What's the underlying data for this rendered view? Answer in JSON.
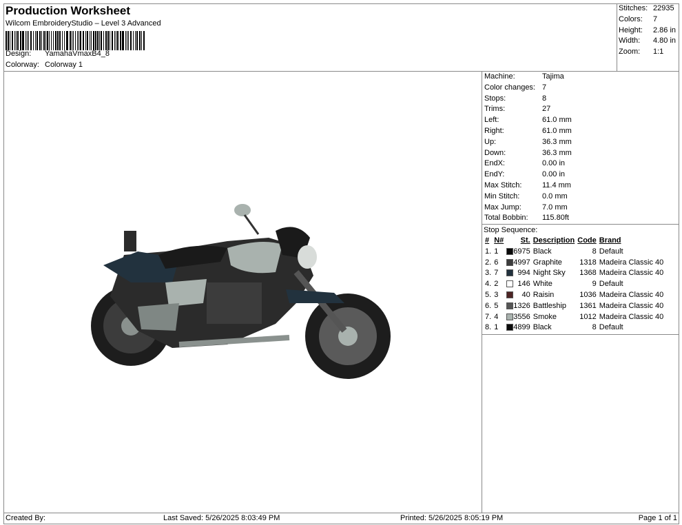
{
  "header": {
    "title": "Production Worksheet",
    "subtitle": "Wilcom EmbroideryStudio – Level 3 Advanced",
    "design_label": "Design:",
    "design": "YamahaVmaxB4_8",
    "colorway_label": "Colorway:",
    "colorway": "Colorway 1"
  },
  "summary": [
    {
      "k": "Stitches:",
      "v": "22935"
    },
    {
      "k": "Colors:",
      "v": "7"
    },
    {
      "k": "Height:",
      "v": "2.86 in"
    },
    {
      "k": "Width:",
      "v": "4.80 in"
    },
    {
      "k": "Zoom:",
      "v": "1:1"
    }
  ],
  "info": [
    {
      "k": "Machine:",
      "v": "Tajima"
    },
    {
      "k": "Color changes:",
      "v": "7"
    },
    {
      "k": "Stops:",
      "v": "8"
    },
    {
      "k": "Trims:",
      "v": "27"
    },
    {
      "k": "Left:",
      "v": "61.0 mm"
    },
    {
      "k": "Right:",
      "v": "61.0 mm"
    },
    {
      "k": "Up:",
      "v": "36.3 mm"
    },
    {
      "k": "Down:",
      "v": "36.3 mm"
    },
    {
      "k": "EndX:",
      "v": "0.00 in"
    },
    {
      "k": "EndY:",
      "v": "0.00 in"
    },
    {
      "k": "Max Stitch:",
      "v": "11.4 mm"
    },
    {
      "k": "Min Stitch:",
      "v": "0.0 mm"
    },
    {
      "k": "Max Jump:",
      "v": "7.0 mm"
    },
    {
      "k": "Total Bobbin:",
      "v": "115.80ft"
    }
  ],
  "stops": {
    "caption": "Stop Sequence:",
    "headers": [
      "#",
      "N#",
      "St.",
      "Description",
      "Code",
      "Brand"
    ],
    "rows": [
      {
        "n": "1.",
        "nn": "1",
        "color": "#0a0a0a",
        "st": "6975",
        "desc": "Black",
        "code": "8",
        "brand": "Default"
      },
      {
        "n": "2.",
        "nn": "6",
        "color": "#3c3c3c",
        "st": "4997",
        "desc": "Graphite",
        "code": "1318",
        "brand": "Madeira Classic 40"
      },
      {
        "n": "3.",
        "nn": "7",
        "color": "#22323e",
        "st": "994",
        "desc": "Night Sky",
        "code": "1368",
        "brand": "Madeira Classic 40"
      },
      {
        "n": "4.",
        "nn": "2",
        "color": "#ffffff",
        "st": "146",
        "desc": "White",
        "code": "9",
        "brand": "Default"
      },
      {
        "n": "5.",
        "nn": "3",
        "color": "#4d2424",
        "st": "40",
        "desc": "Raisin",
        "code": "1036",
        "brand": "Madeira Classic 40"
      },
      {
        "n": "6.",
        "nn": "5",
        "color": "#565656",
        "st": "1326",
        "desc": "Battleship",
        "code": "1361",
        "brand": "Madeira Classic 40"
      },
      {
        "n": "7.",
        "nn": "4",
        "color": "#a9b2ae",
        "st": "3556",
        "desc": "Smoke",
        "code": "1012",
        "brand": "Madeira Classic 40"
      },
      {
        "n": "8.",
        "nn": "1",
        "color": "#0a0a0a",
        "st": "4899",
        "desc": "Black",
        "code": "8",
        "brand": "Default"
      }
    ]
  },
  "footer": {
    "created": "Created By:",
    "saved": "Last Saved: 5/26/2025 8:03:49 PM",
    "printed": "Printed: 5/26/2025 8:05:19 PM",
    "page": "Page 1 of 1"
  }
}
